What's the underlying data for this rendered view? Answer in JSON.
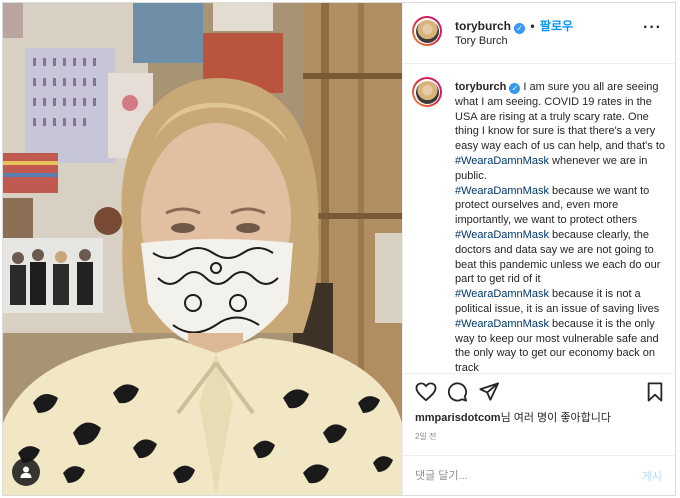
{
  "post": {
    "username": "toryburch",
    "follow_label": "팔로우",
    "separator": "•",
    "subtitle": "Tory Burch",
    "more_icon": "ellipsis-icon",
    "verified_icon": "verified-badge-icon"
  },
  "caption": {
    "username": "toryburch",
    "lines": [
      {
        "text": "I am sure you all are seeing what I am seeing. COVID 19 rates in the USA are rising at a truly scary rate. One thing I know for sure is that there's a very easy way each of us can help, and that's to ",
        "hashtag": "#WearaDamnMask",
        "after": " whenever we are in public."
      },
      {
        "text": "",
        "hashtag": "#WearaDamnMask",
        "after": " because we want to protect ourselves and, even more importantly, we want to protect others"
      },
      {
        "text": "",
        "hashtag": "#WearaDamnMask",
        "after": " because clearly, the doctors and data say we are not going to beat this pandemic unless we each do our part to get rid of it"
      },
      {
        "text": "",
        "hashtag": "#WearaDamnMask",
        "after": " because it is not a political issue, it is an issue of saving lives"
      },
      {
        "text": "",
        "hashtag": "#WearaDamnMask",
        "after": " because it is the only way to keep our most vulnerable safe and the only way to get our economy back on track"
      }
    ]
  },
  "actions": {
    "like_icon": "heart-icon",
    "comment_icon": "comment-icon",
    "share_icon": "paper-plane-icon",
    "save_icon": "bookmark-icon"
  },
  "likes": {
    "user": "mmparisdotcom",
    "rest": "님 여러 명이 좋아합니다"
  },
  "timestamp": "2일 전",
  "comment_box": {
    "placeholder": "댓글 달기...",
    "post_label": "게시"
  },
  "photo": {
    "user_tag_icon": "user-tag-icon"
  },
  "colors": {
    "link_blue": "#0095f6",
    "hashtag": "#00376b",
    "verified": "#3897f0",
    "post_disabled": "#b3dbff"
  }
}
